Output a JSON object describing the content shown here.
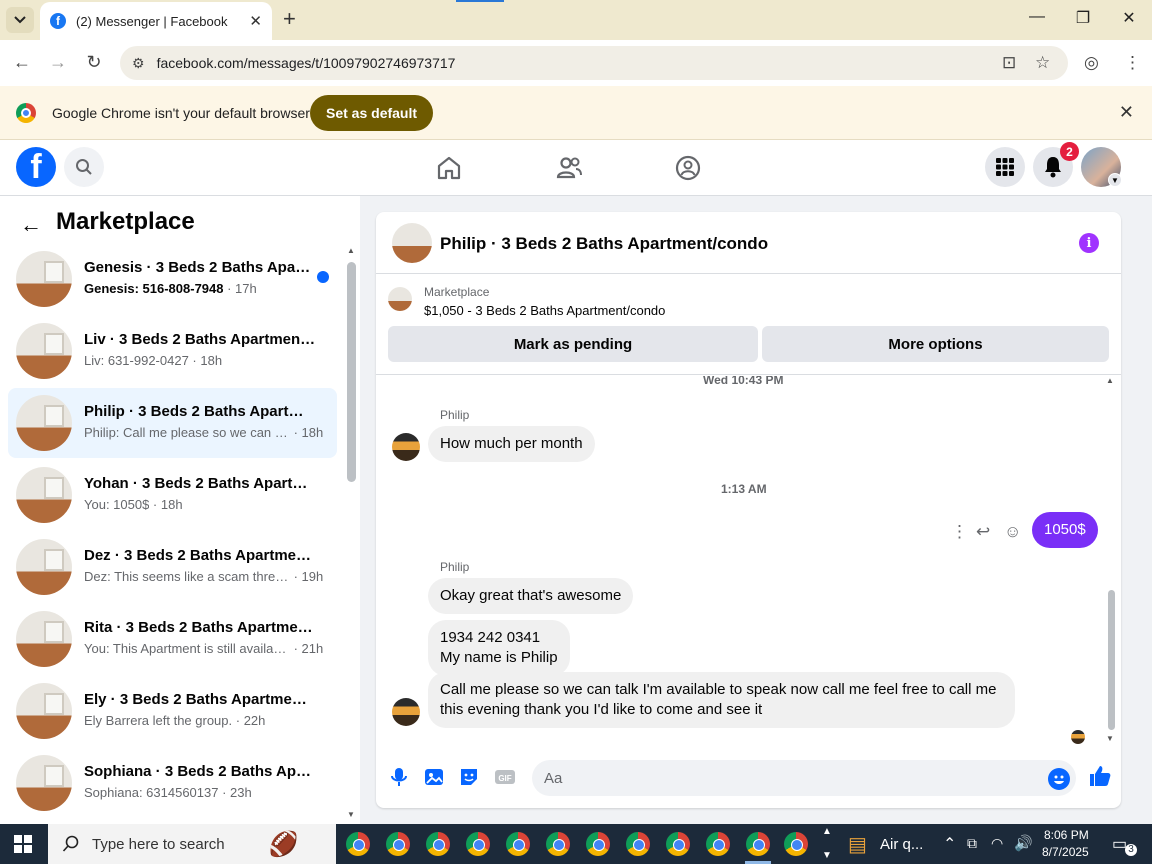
{
  "browser": {
    "tab_title": "(2) Messenger | Facebook",
    "tab_favicon_letter": "f",
    "url": "facebook.com/messages/t/10097902746973717",
    "infobar_text": "Google Chrome isn't your default browser",
    "infobar_button": "Set as default"
  },
  "facebook": {
    "logo_letter": "f",
    "notification_count": "2"
  },
  "sidebar": {
    "title": "Marketplace",
    "conversations": [
      {
        "name": "Genesis · 3 Beds 2 Baths Apart...",
        "preview": "Genesis: 516-808-7948",
        "time": " · 17h",
        "unread": true
      },
      {
        "name": "Liv · 3 Beds 2 Baths Apartment/c...",
        "preview": "Liv: 631-992-0427",
        "time": " · 18h"
      },
      {
        "name": "Philip · 3 Beds 2 Baths Apartme...",
        "preview": "Philip: Call me please so we can ta...",
        "time": " · 18h",
        "active": true
      },
      {
        "name": "Yohan · 3 Beds 2 Baths Apartme...",
        "preview": "You: 1050$",
        "time": " · 18h"
      },
      {
        "name": "Dez · 3 Beds 2 Baths Apartment/...",
        "preview": "Dez: This seems like a scam three ...",
        "time": " · 19h"
      },
      {
        "name": "Rita · 3 Beds 2 Baths Apartment...",
        "preview": "You: This Apartment is still availabl...",
        "time": " · 21h"
      },
      {
        "name": "Ely · 3 Beds 2 Baths Apartment/...",
        "preview": "Ely Barrera left the group.",
        "time": " · 22h"
      },
      {
        "name": "Sophiana · 3 Beds 2 Baths Apart...",
        "preview": "Sophiana: 6314560137",
        "time": " · 23h"
      }
    ]
  },
  "chat": {
    "title": "Philip · 3 Beds 2 Baths Apartment/condo",
    "listing_category": "Marketplace",
    "listing_desc": "$1,050 - 3 Beds 2 Baths Apartment/condo",
    "mark_pending": "Mark as pending",
    "more_options": "More options",
    "timestamp1": "Wed 10:43 PM",
    "timestamp2": "1:13 AM",
    "sender": "Philip",
    "msg1": "How much per month",
    "my_msg": "1050$",
    "msg2": "Okay great that's awesome",
    "msg3_line1": "1934 242 0341",
    "msg3_line2": "My name is Philip",
    "msg4_line1": "Call me please so we can talk I'm available to speak now call me feel free to call me",
    "msg4_line2": "this evening thank you I'd like to come and see it",
    "composer_placeholder": "Aa"
  },
  "taskbar": {
    "search_placeholder": "Type here to search",
    "weather": "Air q...",
    "time": "8:06 PM",
    "date": "8/7/2025",
    "notifications": "3"
  },
  "colors": {
    "messenger_purple": "#7a2ff7",
    "fb_blue": "#0866ff",
    "info_purple": "#a033ff",
    "notification_red": "#e41e3f"
  }
}
